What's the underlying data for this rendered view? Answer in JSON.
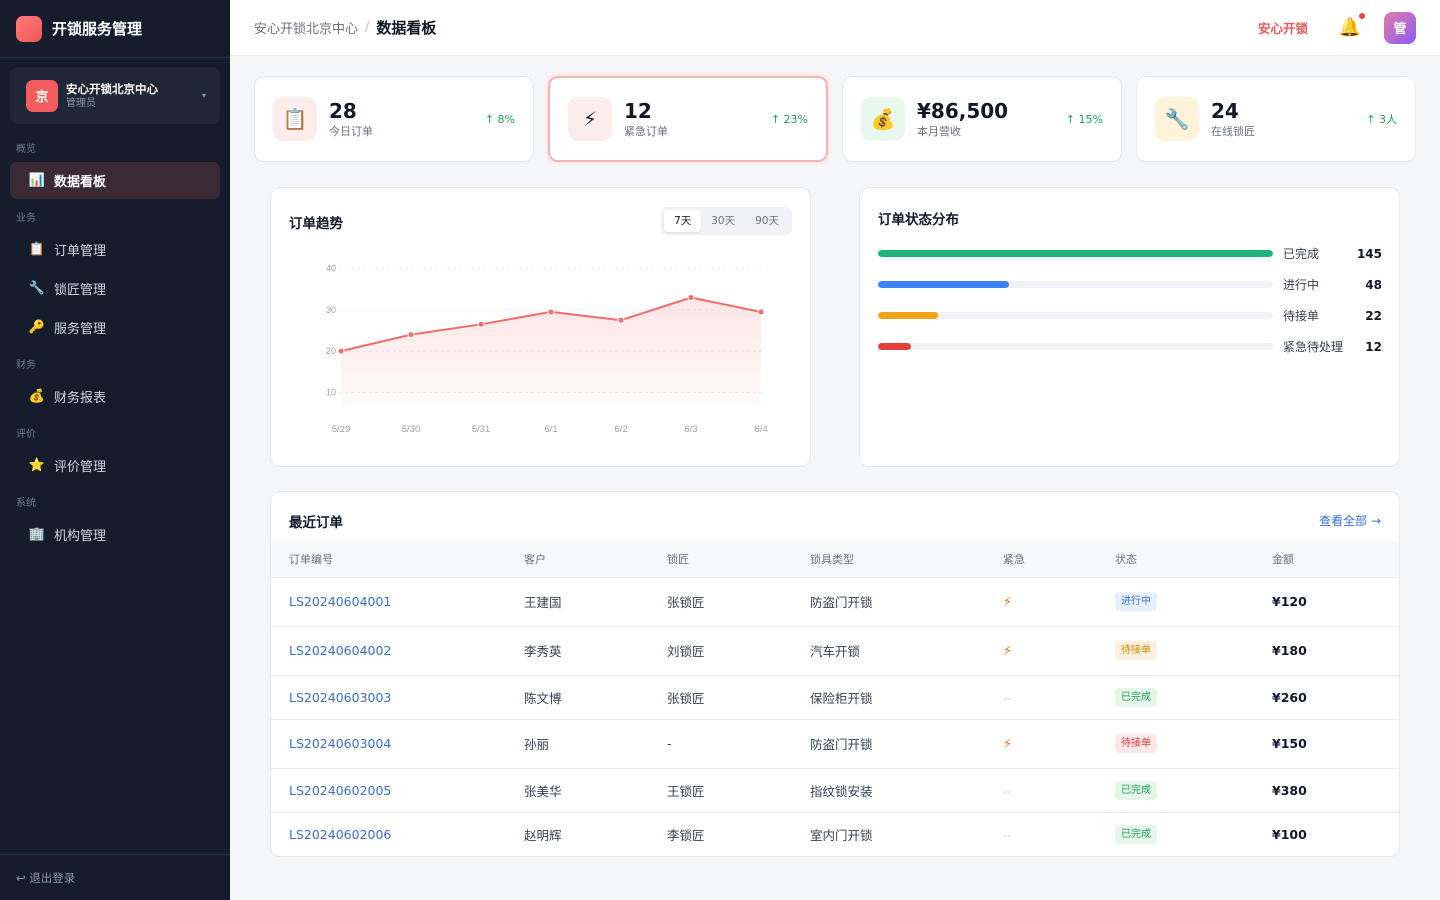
{
  "sidebar": {
    "brand_title": "开锁服务管理",
    "org": {
      "avatar": "京",
      "name": "安心开锁北京中心",
      "role": "管理员",
      "caret": "▾"
    },
    "groups": [
      {
        "label": "概览",
        "items": [
          {
            "icon": "📊",
            "label": "数据看板",
            "active": true
          }
        ]
      },
      {
        "label": "业务",
        "items": [
          {
            "icon": "📋",
            "label": "订单管理"
          },
          {
            "icon": "🔧",
            "label": "锁匠管理"
          },
          {
            "icon": "🔑",
            "label": "服务管理"
          }
        ]
      },
      {
        "label": "财务",
        "items": [
          {
            "icon": "💰",
            "label": "财务报表"
          }
        ]
      },
      {
        "label": "评价",
        "items": [
          {
            "icon": "⭐",
            "label": "评价管理"
          }
        ]
      },
      {
        "label": "系统",
        "items": [
          {
            "icon": "🏢",
            "label": "机构管理"
          }
        ]
      }
    ],
    "logout_label": "↩ 退出登录"
  },
  "header": {
    "breadcrumb_parent": "安心开锁北京中心",
    "breadcrumb_sep": "/",
    "breadcrumb_current": "数据看板",
    "brand_link": "安心开锁",
    "user_avatar": "管"
  },
  "stats": [
    {
      "icon": "📋",
      "value": "28",
      "label": "今日订单",
      "trend": "↑ 8%",
      "icon_bg": "#fdecec"
    },
    {
      "icon": "⚡",
      "value": "12",
      "label": "紧急订单",
      "trend": "↑ 23%",
      "icon_bg": "#fdecec"
    },
    {
      "icon": "💰",
      "value": "¥86,500",
      "label": "本月营收",
      "trend": "↑ 15%",
      "icon_bg": "#e9f8ef"
    },
    {
      "icon": "🔧",
      "value": "24",
      "label": "在线锁匠",
      "trend": "↑ 3人",
      "icon_bg": "#fdf3d8"
    }
  ],
  "trend": {
    "title": "订单趋势",
    "ranges": [
      "7天",
      "30天",
      "90天"
    ],
    "selected_range": "7天"
  },
  "chart_data": {
    "type": "area",
    "categories": [
      "5/29",
      "5/30",
      "5/31",
      "6/1",
      "6/2",
      "6/3",
      "6/4"
    ],
    "values": [
      20,
      24,
      26.5,
      29.5,
      27.5,
      33,
      29.5
    ],
    "y_ticks": [
      10,
      20,
      30,
      40
    ],
    "ylim": [
      5,
      45
    ],
    "grid": true,
    "color": "#f26b6b"
  },
  "status": {
    "title": "订单状态分布",
    "items": [
      {
        "label": "已完成",
        "count": 145,
        "color": "#1fb57a"
      },
      {
        "label": "进行中",
        "count": 48,
        "color": "#3b82f6"
      },
      {
        "label": "待接单",
        "count": 22,
        "color": "#f0a51a"
      },
      {
        "label": "紧急待处理",
        "count": 12,
        "color": "#e53e3e"
      }
    ]
  },
  "recent": {
    "title": "最近订单",
    "view_all": "查看全部 →",
    "columns": [
      "订单编号",
      "客户",
      "锁匠",
      "锁具类型",
      "紧急",
      "状态",
      "金额"
    ],
    "rows": [
      {
        "id": "LS20240604001",
        "customer": "王建国",
        "smith": "张锁匠",
        "lock": "防盗门开锁",
        "urgent": true,
        "status": "进行中",
        "amount": "¥120"
      },
      {
        "id": "LS20240604002",
        "customer": "李秀英",
        "smith": "刘锁匠",
        "lock": "汽车开锁",
        "urgent": true,
        "status": "待接单",
        "amount": "¥180"
      },
      {
        "id": "LS20240603003",
        "customer": "陈文博",
        "smith": "张锁匠",
        "lock": "保险柜开锁",
        "urgent": false,
        "status": "已完成",
        "amount": "¥260"
      },
      {
        "id": "LS20240603004",
        "customer": "孙丽",
        "smith": "-",
        "lock": "防盗门开锁",
        "urgent": true,
        "status": "待接单",
        "amount": "¥150"
      },
      {
        "id": "LS20240602005",
        "customer": "张美华",
        "smith": "王锁匠",
        "lock": "指纹锁安装",
        "urgent": false,
        "status": "已完成",
        "amount": "¥380"
      },
      {
        "id": "LS20240602006",
        "customer": "赵明辉",
        "smith": "李锁匠",
        "lock": "室内门开锁",
        "urgent": false,
        "status": "已完成",
        "amount": "¥100"
      }
    ],
    "urgent_yes": "⚡",
    "urgent_no": "--",
    "status_styles": {
      "进行中": {
        "bg": "#e8f0fe",
        "fg": "#3b6fd6"
      },
      "待接单": {
        "bg": "#fdf1dd",
        "fg": "#d98a0b"
      },
      "待接单-urgent": {
        "bg": "#fde8e8",
        "fg": "#d94040"
      },
      "已完成": {
        "bg": "#e6f6ec",
        "fg": "#1f9d55"
      }
    }
  }
}
